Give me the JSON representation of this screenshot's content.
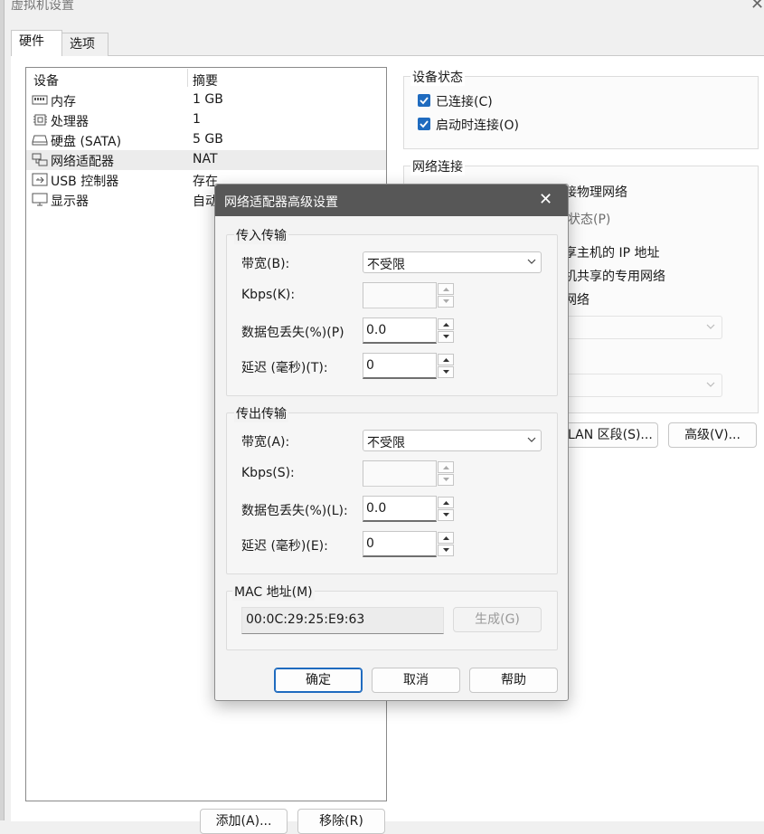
{
  "window": {
    "title": "虚拟机设置"
  },
  "tabs": [
    {
      "label": "硬件"
    },
    {
      "label": "选项"
    }
  ],
  "device_list": {
    "headers": [
      "设备",
      "摘要"
    ],
    "rows": [
      {
        "name": "内存",
        "summary": "1 GB"
      },
      {
        "name": "处理器",
        "summary": "1"
      },
      {
        "name": "硬盘 (SATA)",
        "summary": "5 GB"
      },
      {
        "name": "网络适配器",
        "summary": "NAT"
      },
      {
        "name": "USB 控制器",
        "summary": "存在"
      },
      {
        "name": "显示器",
        "summary": "自动"
      }
    ],
    "add_button": "添加(A)...",
    "remove_button": "移除(R)"
  },
  "device_status": {
    "title": "设备状态",
    "connected": "已连接(C)",
    "connect_on_power": "启动时连接(O)"
  },
  "network_connection": {
    "title": "网络连接",
    "fragments": [
      "接物理网络",
      "状态(P)",
      "享主机的 IP 地址",
      "机共享的专用网络",
      "网络"
    ],
    "lan_segment_button": "LAN 区段(S)...",
    "advanced_button": "高级(V)..."
  },
  "modal": {
    "title": "网络适配器高级设置",
    "incoming": {
      "title": "传入传输",
      "bandwidth_label": "带宽(B):",
      "bandwidth_value": "不受限",
      "kbps_label": "Kbps(K):",
      "kbps_value": "",
      "loss_label": "数据包丢失(%)(P)",
      "loss_value": "0.0",
      "latency_label": "延迟 (毫秒)(T):",
      "latency_value": "0"
    },
    "outgoing": {
      "title": "传出传输",
      "bandwidth_label": "带宽(A):",
      "bandwidth_value": "不受限",
      "kbps_label": "Kbps(S):",
      "kbps_value": "",
      "loss_label": "数据包丢失(%)(L):",
      "loss_value": "0.0",
      "latency_label": "延迟 (毫秒)(E):",
      "latency_value": "0"
    },
    "mac": {
      "title": "MAC 地址(M)",
      "value": "00:0C:29:25:E9:63",
      "generate_button": "生成(G)"
    },
    "ok_button": "确定",
    "cancel_button": "取消",
    "help_button": "帮助"
  }
}
